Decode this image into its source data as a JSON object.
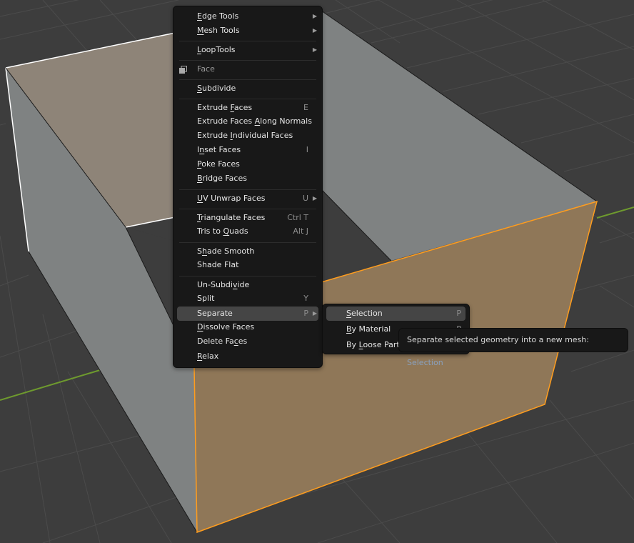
{
  "viewport": {
    "background": "#3d3d3d",
    "grid_color": "#4a4a4a",
    "y_axis_color": "#6e9a2e",
    "selected_face_color": "#8f7758",
    "unselected_face_color": "#7f8282",
    "back_face_color": "#8e8478",
    "selected_edge_color": "#ff9d1e"
  },
  "context_menu": {
    "header": {
      "label": "Face",
      "icon": "face-select-icon"
    },
    "items": [
      {
        "id": "edge-tools",
        "pre": "",
        "u": "E",
        "post": "dge Tools",
        "shortcut": "",
        "submenu": true
      },
      {
        "id": "mesh-tools",
        "pre": "",
        "u": "M",
        "post": "esh Tools",
        "shortcut": "",
        "submenu": true
      },
      {
        "id": "looptools",
        "pre": "",
        "u": "L",
        "post": "oopTools",
        "shortcut": "",
        "submenu": true
      },
      {
        "id": "subdivide",
        "pre": "",
        "u": "S",
        "post": "ubdivide",
        "shortcut": "",
        "submenu": false
      },
      {
        "id": "extrude-faces",
        "pre": "Extrude ",
        "u": "F",
        "post": "aces",
        "shortcut": "E",
        "submenu": false
      },
      {
        "id": "extrude-faces-along-normals",
        "pre": "Extrude Faces ",
        "u": "A",
        "post": "long Normals",
        "shortcut": "",
        "submenu": false
      },
      {
        "id": "extrude-individual-faces",
        "pre": "Extrude ",
        "u": "I",
        "post": "ndividual Faces",
        "shortcut": "",
        "submenu": false
      },
      {
        "id": "inset-faces",
        "pre": "I",
        "u": "n",
        "post": "set Faces",
        "shortcut": "I",
        "submenu": false
      },
      {
        "id": "poke-faces",
        "pre": "",
        "u": "P",
        "post": "oke Faces",
        "shortcut": "",
        "submenu": false
      },
      {
        "id": "bridge-faces",
        "pre": "",
        "u": "B",
        "post": "ridge Faces",
        "shortcut": "",
        "submenu": false
      },
      {
        "id": "uv-unwrap-faces",
        "pre": "",
        "u": "U",
        "post": "V Unwrap Faces",
        "shortcut": "U",
        "submenu": true
      },
      {
        "id": "triangulate-faces",
        "pre": "",
        "u": "T",
        "post": "riangulate Faces",
        "shortcut": "Ctrl T",
        "submenu": false
      },
      {
        "id": "tris-to-quads",
        "pre": "Tris to ",
        "u": "Q",
        "post": "uads",
        "shortcut": "Alt J",
        "submenu": false
      },
      {
        "id": "shade-smooth",
        "pre": "S",
        "u": "h",
        "post": "ade Smooth",
        "shortcut": "",
        "submenu": false
      },
      {
        "id": "shade-flat",
        "pre": "Shade Flat",
        "u": "",
        "post": "",
        "shortcut": "",
        "submenu": false
      },
      {
        "id": "un-subdivide",
        "pre": "Un-Subdi",
        "u": "v",
        "post": "ide",
        "shortcut": "",
        "submenu": false
      },
      {
        "id": "split",
        "pre": "Split",
        "u": "",
        "post": "",
        "shortcut": "Y",
        "submenu": false
      },
      {
        "id": "separate",
        "pre": "Separate",
        "u": "",
        "post": "",
        "shortcut": "P",
        "submenu": true,
        "highlighted": true
      },
      {
        "id": "dissolve-faces",
        "pre": "",
        "u": "D",
        "post": "issolve Faces",
        "shortcut": "",
        "submenu": false
      },
      {
        "id": "delete-faces",
        "pre": "Delete Fa",
        "u": "c",
        "post": "es",
        "shortcut": "",
        "submenu": false
      },
      {
        "id": "relax",
        "pre": "",
        "u": "R",
        "post": "elax",
        "shortcut": "",
        "submenu": false
      }
    ]
  },
  "separate_submenu": {
    "items": [
      {
        "id": "selection",
        "pre": "",
        "u": "S",
        "post": "election",
        "shortcut": "P",
        "highlighted": true
      },
      {
        "id": "by-material",
        "pre": "",
        "u": "B",
        "post": "y Material",
        "shortcut": "P"
      },
      {
        "id": "by-loose-parts",
        "pre": "By ",
        "u": "L",
        "post": "oose Parts",
        "shortcut": ""
      }
    ]
  },
  "tooltip": {
    "text": "Separate selected geometry into a new mesh:",
    "value": "Selection"
  },
  "glyphs": {
    "submenu_arrow": "▶"
  }
}
